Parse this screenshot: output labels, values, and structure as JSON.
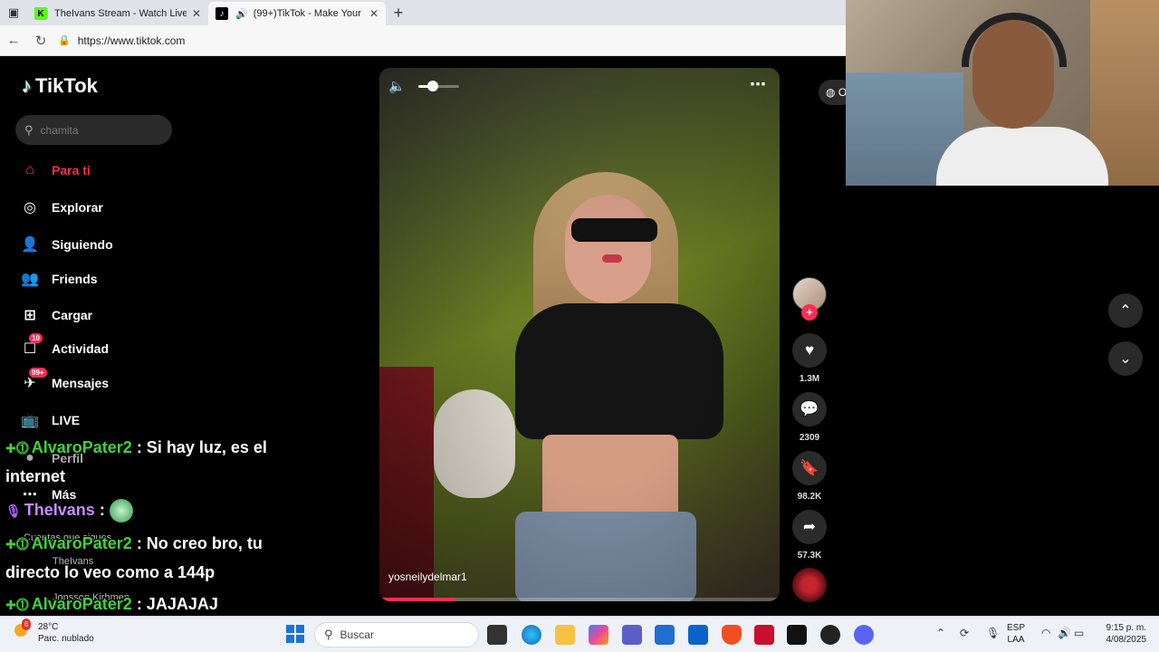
{
  "browser": {
    "tabs": [
      {
        "title": "TheIvans Stream - Watch Live on K",
        "favicon": "kick-icon",
        "favicon_color": "#53fc18"
      },
      {
        "title": "(99+)TikTok - Make Your Day",
        "favicon": "tiktok-icon",
        "favicon_color": "#000000",
        "audio": true
      }
    ],
    "url": "https://www.tiktok.com"
  },
  "tiktok": {
    "logo": "TikTok",
    "search_placeholder": "chamita",
    "nav": [
      {
        "label": "Para ti",
        "icon": "home-icon",
        "active": true
      },
      {
        "label": "Explorar",
        "icon": "compass-icon"
      },
      {
        "label": "Siguiendo",
        "icon": "following-icon"
      },
      {
        "label": "Friends",
        "icon": "friends-icon"
      },
      {
        "label": "Cargar",
        "icon": "upload-icon"
      },
      {
        "label": "Actividad",
        "icon": "activity-icon",
        "badge": "10"
      },
      {
        "label": "Mensajes",
        "icon": "messages-icon",
        "badge": "99+"
      },
      {
        "label": "LIVE",
        "icon": "live-icon"
      },
      {
        "label": "Perfil",
        "icon": "profile-icon"
      },
      {
        "label": "Más",
        "icon": "more-icon"
      }
    ],
    "following_heading": "Cuentas que sigues",
    "following_accounts": [
      "TheIvans",
      "Jonsson Kirhmen"
    ],
    "video": {
      "author": "yosneilydelmar1",
      "volume": 0.35,
      "progress": 0.19
    },
    "actions": {
      "likes": "1.3M",
      "comments": "2309",
      "saves": "98.2K",
      "shares": "57.3K"
    },
    "chip_label": "O"
  },
  "chat": [
    {
      "user": "AlvaroPater2",
      "text": ": Si hay luz, es el",
      "cont": "internet",
      "color": "green"
    },
    {
      "user": "TheIvans",
      "text": ":",
      "color": "purple",
      "emote": true
    },
    {
      "user": "AlvaroPater2",
      "text": ": No creo bro, tu",
      "cont": "directo lo veo como a 144p",
      "color": "green"
    },
    {
      "user": "AlvaroPater2",
      "text": ": JAJAJAJ",
      "color": "green"
    }
  ],
  "taskbar": {
    "weather_temp": "28°C",
    "weather_desc": "Parc. nublado",
    "weather_badge": "6",
    "search_label": "Buscar",
    "lang_top": "ESP",
    "lang_bottom": "LAA",
    "time": "9:15 p. m.",
    "date": "4/08/2025"
  }
}
